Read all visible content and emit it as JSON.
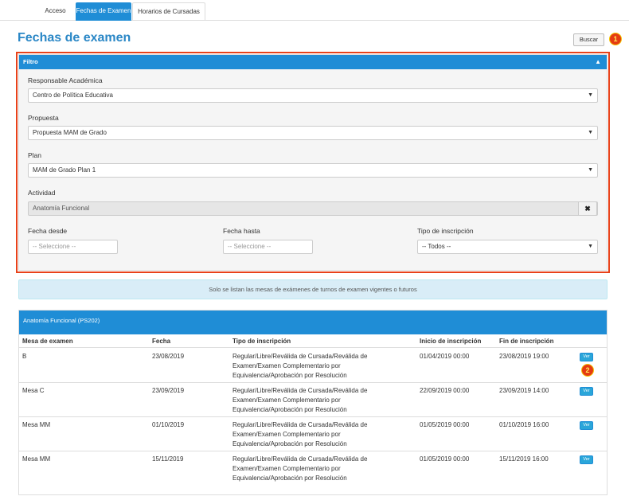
{
  "tabs": [
    {
      "label": "Acceso"
    },
    {
      "label": "Fechas de Examen"
    },
    {
      "label": "Horarios de Cursadas"
    }
  ],
  "page_title": "Fechas de examen",
  "buscar_label": "Buscar",
  "markers": [
    "1",
    "2"
  ],
  "filter": {
    "header": "Filtro",
    "fields": {
      "responsable": {
        "label": "Responsable Académica",
        "value": "Centro de Política Educativa"
      },
      "propuesta": {
        "label": "Propuesta",
        "value": "Propuesta MAM de Grado"
      },
      "plan": {
        "label": "Plan",
        "value": "MAM de Grado Plan 1"
      },
      "actividad": {
        "label": "Actividad",
        "value": "Anatomía Funcional"
      },
      "fecha_desde": {
        "label": "Fecha desde",
        "placeholder": "-- Seleccione --"
      },
      "fecha_hasta": {
        "label": "Fecha hasta",
        "placeholder": "-- Seleccione --"
      },
      "tipo_inscripcion": {
        "label": "Tipo de inscripción",
        "value": "-- Todos --"
      }
    }
  },
  "notice": "Solo se listan las mesas de exámenes de turnos de examen vigentes o futuros",
  "results": {
    "title": "Anatomía Funcional (PS202)",
    "columns": [
      "Mesa de examen",
      "Fecha",
      "Tipo de inscripción",
      "Inicio de inscripción",
      "Fin de inscripción"
    ],
    "rows": [
      {
        "mesa": "B",
        "fecha": "23/08/2019",
        "tipo": "Regular/Libre/Reválida de Cursada/Reválida de Examen/Examen Complementario por Equivalencia/Aprobación por Resolución",
        "inicio": "01/04/2019 00:00",
        "fin": "23/08/2019 19:00",
        "action": "Ver"
      },
      {
        "mesa": "Mesa C",
        "fecha": "23/09/2019",
        "tipo": "Regular/Libre/Reválida de Cursada/Reválida de Examen/Examen Complementario por Equivalencia/Aprobación por Resolución",
        "inicio": "22/09/2019 00:00",
        "fin": "23/09/2019 14:00",
        "action": "Ver"
      },
      {
        "mesa": "Mesa MM",
        "fecha": "01/10/2019",
        "tipo": "Regular/Libre/Reválida de Cursada/Reválida de Examen/Examen Complementario por Equivalencia/Aprobación por Resolución",
        "inicio": "01/05/2019 00:00",
        "fin": "01/10/2019 16:00",
        "action": "Ver"
      },
      {
        "mesa": "Mesa MM",
        "fecha": "15/11/2019",
        "tipo": "Regular/Libre/Reválida de Cursada/Reválida de Examen/Examen Complementario por Equivalencia/Aprobación por Resolución",
        "inicio": "01/05/2019 00:00",
        "fin": "15/11/2019 16:00",
        "action": "Ver"
      }
    ]
  },
  "icons": {
    "collapse": "chevron-up-icon",
    "dropdown": "caret-down-icon",
    "clear": "close-icon"
  },
  "colors": {
    "primary": "#1f8dd6",
    "title": "#2a87c6",
    "highlight": "#e8421a",
    "notice_bg": "#d9edf7"
  }
}
